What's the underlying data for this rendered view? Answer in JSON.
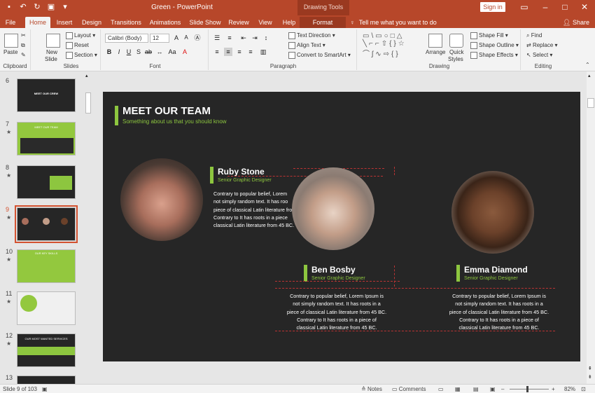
{
  "window": {
    "title": "Green  -  PowerPoint",
    "contextual_header": "Drawing Tools",
    "sign_in": "Sign in"
  },
  "tabs": [
    "File",
    "Home",
    "Insert",
    "Design",
    "Transitions",
    "Animations",
    "Slide Show",
    "Review",
    "View",
    "Help",
    "Format"
  ],
  "active_tab": "Home",
  "tell_me": "Tell me what you want to do",
  "share": "Share",
  "ribbon": {
    "clipboard": {
      "label": "Clipboard",
      "paste": "Paste"
    },
    "slides": {
      "label": "Slides",
      "new_slide_1": "New",
      "new_slide_2": "Slide",
      "layout": "Layout",
      "reset": "Reset",
      "section": "Section"
    },
    "font": {
      "label": "Font",
      "family": "Calibri (Body)",
      "size": "12"
    },
    "paragraph": {
      "label": "Paragraph",
      "text_direction": "Text Direction",
      "align_text": "Align Text",
      "convert_smartart": "Convert to SmartArt"
    },
    "drawing": {
      "label": "Drawing",
      "arrange": "Arrange",
      "quick_styles_1": "Quick",
      "quick_styles_2": "Styles",
      "shape_fill": "Shape Fill",
      "shape_outline": "Shape Outline",
      "shape_effects": "Shape Effects"
    },
    "editing": {
      "label": "Editing",
      "find": "Find",
      "replace": "Replace",
      "select": "Select"
    }
  },
  "thumbnails": [
    {
      "num": "6",
      "title": "MEET OUR CREW"
    },
    {
      "num": "7",
      "title": "MEET OUR TEAM"
    },
    {
      "num": "8",
      "title": ""
    },
    {
      "num": "9",
      "title": ""
    },
    {
      "num": "10",
      "title": "OUR KEY SKILLS"
    },
    {
      "num": "11",
      "title": ""
    },
    {
      "num": "12",
      "title": "OUR MOST WANTED SERVICES"
    },
    {
      "num": "13",
      "title": ""
    }
  ],
  "slide": {
    "title": "MEET OUR TEAM",
    "subtitle": "Something about us that you should know",
    "members": [
      {
        "name": "Ruby Stone",
        "role": "Senior Graphic Designer",
        "lines": [
          "Contrary to popular belief, Lorem",
          "not simply random text. It has roo",
          "piece of classical Latin literature fro",
          "Contrary to It has roots in a piece",
          "classical Latin literature from 45 BC."
        ]
      },
      {
        "name": "Ben Bosby",
        "role": "Senior Graphic Designer",
        "lines": [
          "Contrary to popular belief, Lorem Ipsum is",
          "not simply random text. It has roots in a",
          "piece of classical Latin literature from 45 BC.",
          "Contrary to It has roots in a piece of",
          "classical Latin literature from 45 BC."
        ]
      },
      {
        "name": "Emma Diamond",
        "role": "Senior Graphic Designer",
        "lines": [
          "Contrary to popular belief, Lorem Ipsum is",
          "not simply random text. It has roots in a",
          "piece of classical Latin literature from 45 BC.",
          "Contrary to It has roots in a piece of",
          "classical Latin literature from 45 BC."
        ]
      }
    ]
  },
  "status": {
    "slide_info": "Slide 9 of 103",
    "notes": "Notes",
    "comments": "Comments",
    "zoom": "82%"
  },
  "colors": {
    "accent": "#b7472a",
    "green": "#8dc63f",
    "slide_bg": "#262626"
  }
}
